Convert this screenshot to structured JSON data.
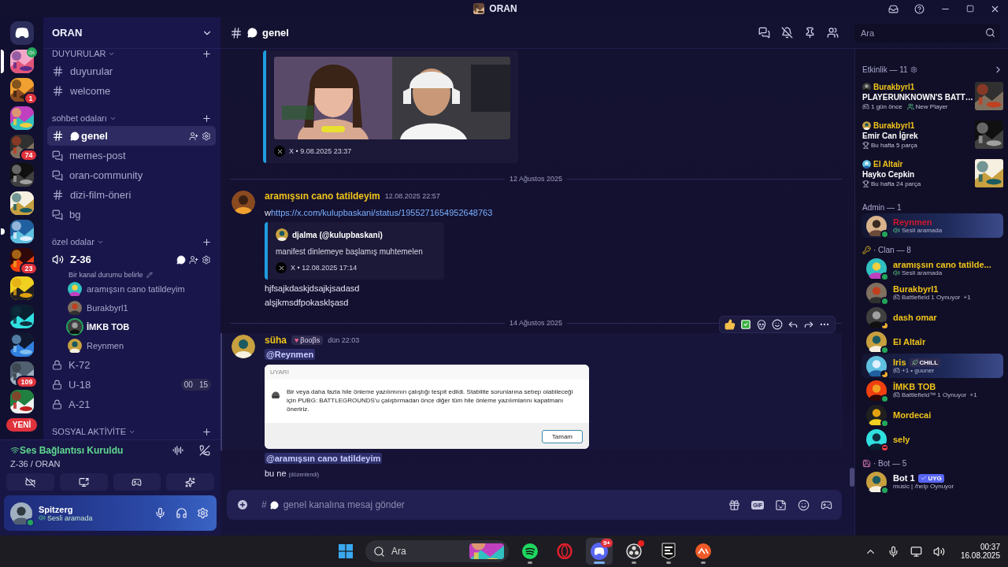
{
  "window": {
    "title": "ORAN"
  },
  "servers": [
    {
      "kind": "home",
      "selected": false,
      "unread": false,
      "voice": false
    },
    {
      "kind": "server",
      "selected": true,
      "unread": false,
      "voice": true
    },
    {
      "kind": "server",
      "selected": false,
      "unread": false,
      "voice": false,
      "badge": "1"
    },
    {
      "kind": "server",
      "selected": false,
      "unread": false,
      "voice": false
    },
    {
      "kind": "server",
      "selected": false,
      "unread": false,
      "voice": false,
      "badge": "74"
    },
    {
      "kind": "server",
      "selected": false,
      "unread": false,
      "voice": false
    },
    {
      "kind": "server",
      "selected": false,
      "unread": false,
      "voice": false
    },
    {
      "kind": "server",
      "selected": false,
      "unread": true,
      "voice": false
    },
    {
      "kind": "server",
      "selected": false,
      "unread": false,
      "voice": false,
      "badge": "23"
    },
    {
      "kind": "server",
      "selected": false,
      "unread": false,
      "voice": false
    },
    {
      "kind": "server",
      "selected": false,
      "unread": false,
      "voice": false
    },
    {
      "kind": "server",
      "selected": false,
      "unread": false,
      "voice": false
    },
    {
      "kind": "server",
      "selected": false,
      "unread": false,
      "voice": false,
      "badge": "109"
    },
    {
      "kind": "server",
      "selected": false,
      "unread": false,
      "voice": false
    }
  ],
  "new_label": "YENİ",
  "sidebar": {
    "server_name": "ORAN",
    "categories": [
      {
        "name": "DUYURULAR",
        "channels": [
          {
            "kind": "text",
            "name": "duyurular",
            "selected": false,
            "connected": false
          },
          {
            "kind": "text",
            "name": "welcome",
            "selected": false,
            "connected": false
          }
        ]
      },
      {
        "name": "sohbet odaları",
        "channels": [
          {
            "kind": "chat",
            "name": "genel",
            "selected": true,
            "connected": false
          },
          {
            "kind": "thread",
            "name": "memes-post",
            "selected": false,
            "connected": false
          },
          {
            "kind": "thread",
            "name": "oran-community",
            "selected": false,
            "connected": false
          },
          {
            "kind": "text",
            "name": "dizi-film-öneri",
            "selected": false,
            "connected": false
          },
          {
            "kind": "thread",
            "name": "bg",
            "selected": false,
            "connected": false
          }
        ]
      },
      {
        "name": "özel odalar",
        "channels": [
          {
            "kind": "voice",
            "name": "Z-36",
            "selected": false,
            "connected": true,
            "status": "Bir kanal durumu belirle",
            "members": [
              {
                "name": "aramışsın cano tatildeyim",
                "speaking": false
              },
              {
                "name": "Burakbyrl1",
                "speaking": false
              },
              {
                "name": "İMKB TOB",
                "speaking": true
              },
              {
                "name": "Reynmen",
                "speaking": false
              }
            ]
          },
          {
            "kind": "voice-locked",
            "name": "K-72",
            "selected": false,
            "connected": false
          },
          {
            "kind": "voice-locked",
            "name": "U-18",
            "selected": false,
            "connected": false,
            "counts": [
              "00",
              "15"
            ]
          },
          {
            "kind": "voice-locked",
            "name": "A-21",
            "selected": false,
            "connected": false
          }
        ]
      },
      {
        "name": "SOSYAL AKTİVİTE"
      }
    ]
  },
  "voice_panel": {
    "status": "Ses Bağlantısı Kuruldu",
    "location": "Z-36 / ORAN"
  },
  "user_panel": {
    "name": "Spitzerg",
    "status": "Sesli aramada"
  },
  "chat": {
    "channel": "genel",
    "search_placeholder": "Ara",
    "messages": [
      {
        "kind": "embed_tail",
        "footer": "X • 9.08.2025 23:37"
      },
      {
        "kind": "divider",
        "text": "12 Ağustos 2025"
      },
      {
        "kind": "message",
        "author": "aramışsın cano tatildeyim",
        "time": "12.08.2025 22:57",
        "hovered": false,
        "prefix": "w",
        "link": "https://x.com/kulupbaskani/status/1955271654952648763",
        "embed": {
          "author": "djalma (@kulupbaskani)",
          "text": "manifest dinlemeye başlamış muhtemelen",
          "footer": "X • 12.08.2025 17:14"
        }
      },
      {
        "kind": "line",
        "text": "hjfsajkdaskjdsajkjsadasd"
      },
      {
        "kind": "line",
        "text": "alşjkmsdfpokasklşasd"
      },
      {
        "kind": "divider",
        "text": "14 Ağustos 2025"
      },
      {
        "kind": "message",
        "author": "süha",
        "role_icon": "♥",
        "role_tag": "βοοβs",
        "time": "dün 22:03",
        "hovered": true,
        "mention": "@Reynmen",
        "dialog": {
          "title": "UYARI",
          "text": "Bir veya daha fazla hile önleme yazılımının çalıştığı tespit edildi. Stabilite sorunlarına sebep olabileceği için PUBG: BATTLEGROUNDS'u çalıştırmadan önce diğer tüm hile önleme yazılımlarını kapatmanı öneririz.",
          "button": "Tamam"
        }
      },
      {
        "kind": "mention",
        "text": "@aramışsın cano tatildeyim"
      },
      {
        "kind": "line",
        "text": "bu ne",
        "edited": "(düzenlendi)"
      }
    ],
    "composer": {
      "hash": "#",
      "placeholder": "genel kanalına mesaj gönder",
      "gif": "GIF"
    }
  },
  "activity": {
    "title": "Etkinlik — 11",
    "items": [
      {
        "user": "Burakbyrl1",
        "title": "PLAYERUNKNOWN'S BATT…",
        "details": [
          {
            "kind": "game",
            "text": "1 gün önce"
          },
          {
            "kind": "player",
            "text": "New Player"
          }
        ]
      },
      {
        "user": "Burakbyrl1",
        "title": "Emir Can İğrek",
        "details": [
          {
            "kind": "trophy",
            "text": "Bu hafta 5 parça"
          }
        ]
      },
      {
        "user": "El Altaîr",
        "title": "Hayko Cepkin",
        "details": [
          {
            "kind": "trophy",
            "text": "Bu hafta 24 parça"
          }
        ]
      }
    ]
  },
  "member_groups": [
    {
      "kind": "plain",
      "title": "Admin — 1",
      "members": [
        {
          "name": "Reynmen",
          "color": "#d0182a",
          "idle": false,
          "dnd": false,
          "banner": true,
          "activity": {
            "kind": "voice",
            "text": "Sesli aramada"
          }
        }
      ]
    },
    {
      "kind": "key",
      "title": "· Clan — 8",
      "members": [
        {
          "name": "aramışsın cano tatilde...",
          "color": "#f0c419",
          "idle": false,
          "dnd": false,
          "banner": false,
          "activity": {
            "kind": "voice",
            "text": "Sesli aramada"
          }
        },
        {
          "name": "Burakbyrl1",
          "color": "#f0c419",
          "idle": false,
          "dnd": false,
          "banner": false,
          "activity": {
            "kind": "game",
            "text": "Battlefield 1 Oynuyor",
            "extra": "+1"
          }
        },
        {
          "name": "dash omar",
          "color": "#f0c419",
          "idle": true,
          "dnd": false,
          "banner": false
        },
        {
          "name": "El Altaîr",
          "color": "#f0c419",
          "idle": false,
          "dnd": false,
          "banner": false
        },
        {
          "name": "Iris",
          "color": "#f0c419",
          "idle": true,
          "dnd": false,
          "banner": true,
          "tag": "CHiLL",
          "activity": {
            "kind": "game",
            "text": "+1 • guuner"
          }
        },
        {
          "name": "İMKB TOB",
          "color": "#f0c419",
          "idle": false,
          "dnd": false,
          "banner": false,
          "activity": {
            "kind": "game",
            "text": "Battlefield™ 1 Oynuyor",
            "extra": "+1"
          }
        },
        {
          "name": "Mordecai",
          "color": "#f0c419",
          "idle": false,
          "dnd": false,
          "banner": false
        },
        {
          "name": "sely",
          "color": "#f0c419",
          "idle": false,
          "dnd": true,
          "banner": false
        }
      ]
    },
    {
      "kind": "floppy",
      "title": "· Bot — 5",
      "members": [
        {
          "name": "Bot 1",
          "color": "#ffffff",
          "idle": false,
          "dnd": false,
          "banner": false,
          "tag": "UYG",
          "activity": {
            "kind": "plain",
            "text": "music | /help Oynuyor"
          }
        }
      ]
    }
  ],
  "taskbar": {
    "search_placeholder": "Ara",
    "apps": [
      {
        "kind": "spotify",
        "selected": false,
        "running": true
      },
      {
        "kind": "opera",
        "selected": false,
        "running": false
      },
      {
        "kind": "discord",
        "selected": true,
        "running": true,
        "badge": "9+"
      },
      {
        "kind": "obs",
        "selected": false,
        "running": true
      },
      {
        "kind": "epic",
        "selected": false,
        "running": true
      },
      {
        "kind": "ea",
        "selected": false,
        "running": true
      }
    ],
    "time": "00:37",
    "date": "16.08.2025"
  }
}
